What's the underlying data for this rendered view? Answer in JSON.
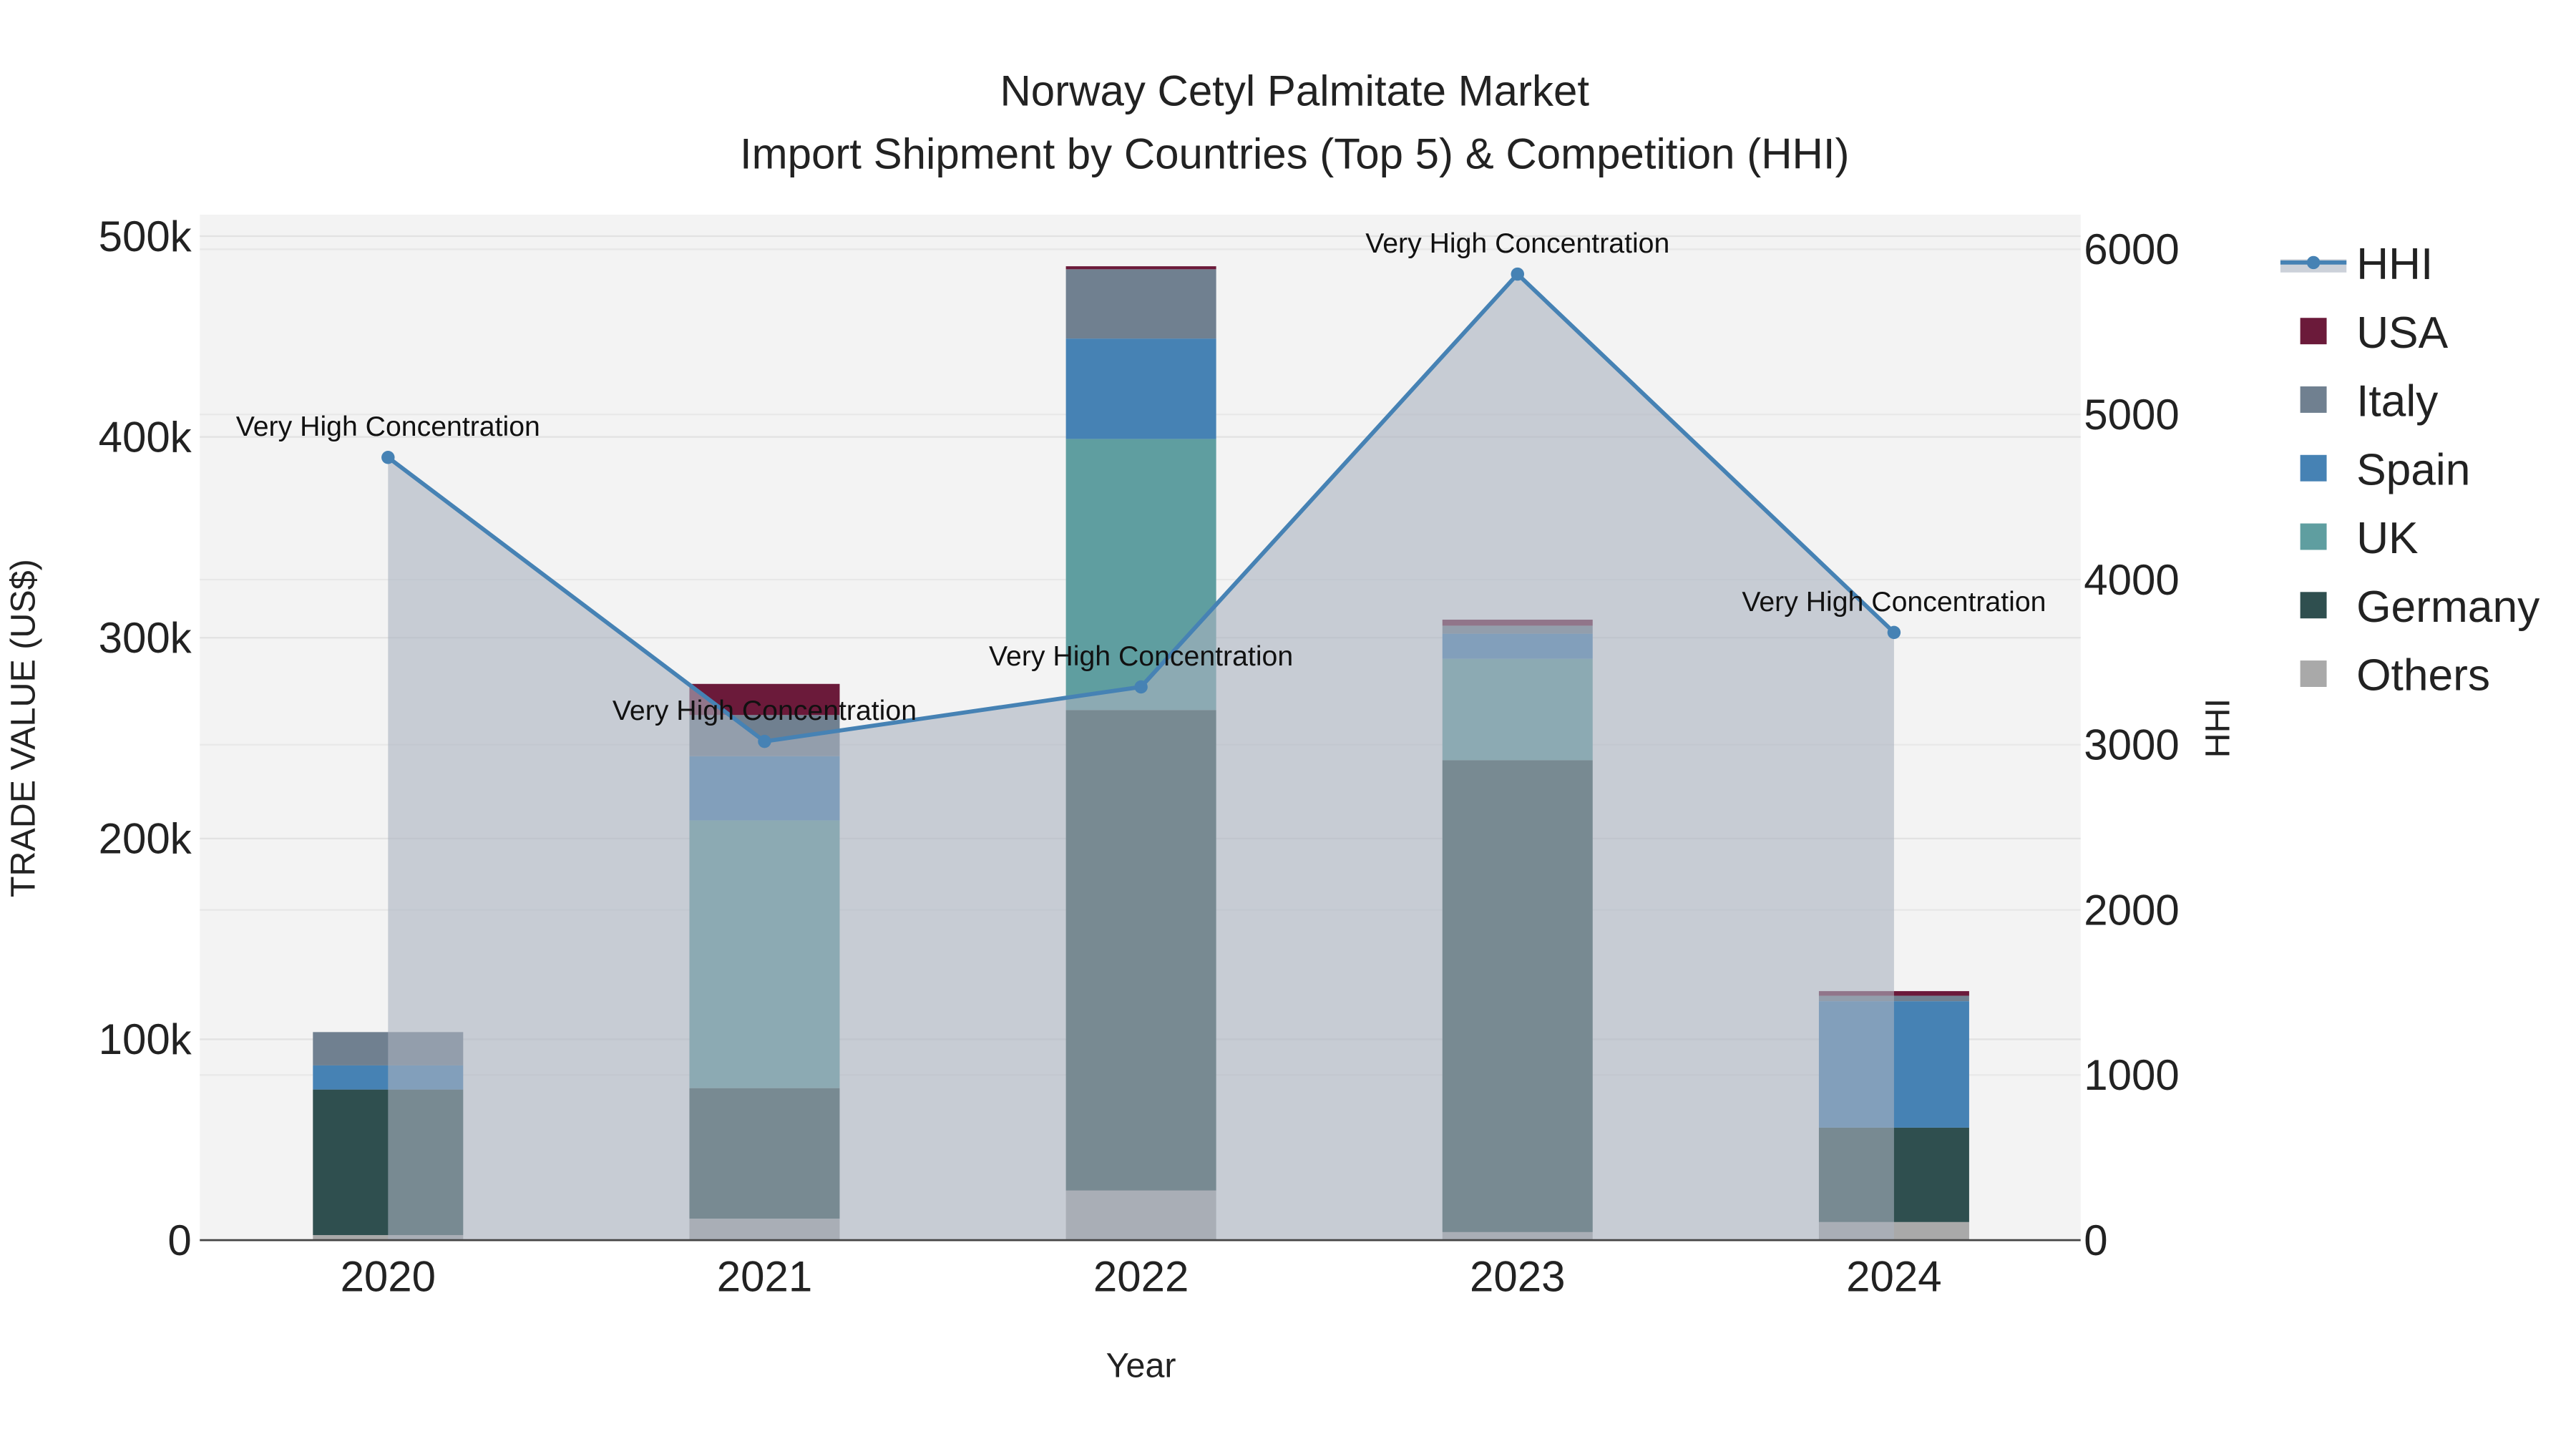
{
  "chart_data": {
    "type": "bar",
    "title": "Norway Cetyl Palmitate Market",
    "subtitle": "Import Shipment by Countries (Top 5) & Competition (HHI)",
    "xlabel": "Year",
    "ylabel": "TRADE VALUE (US$)",
    "y2label": "HHI",
    "categories": [
      "2020",
      "2021",
      "2022",
      "2023",
      "2024"
    ],
    "ylim": [
      0,
      510000
    ],
    "y2lim": [
      0,
      6200
    ],
    "yticks": [
      0,
      100000,
      200000,
      300000,
      400000,
      500000
    ],
    "ytick_labels": [
      "0",
      "100k",
      "200k",
      "300k",
      "400k",
      "500k"
    ],
    "y2ticks": [
      0,
      1000,
      2000,
      3000,
      4000,
      5000,
      6000
    ],
    "y2tick_labels": [
      "0",
      "1000",
      "2000",
      "3000",
      "4000",
      "5000",
      "6000"
    ],
    "stacked": true,
    "series": [
      {
        "name": "Others",
        "color": "#a9a9a9",
        "values": [
          2500,
          10700,
          24700,
          4000,
          9000
        ]
      },
      {
        "name": "Germany",
        "color": "#2f4f4f",
        "values": [
          72500,
          65000,
          239300,
          235000,
          47000
        ]
      },
      {
        "name": "UK",
        "color": "#5f9ea0",
        "values": [
          0,
          133300,
          135000,
          50500,
          0
        ]
      },
      {
        "name": "Spain",
        "color": "#4682b4",
        "values": [
          12000,
          32000,
          50000,
          12500,
          63000
        ]
      },
      {
        "name": "Italy",
        "color": "#708090",
        "values": [
          16600,
          20500,
          34500,
          4000,
          2700
        ]
      },
      {
        "name": "USA",
        "color": "#6b1a3a",
        "values": [
          0,
          15500,
          1500,
          3000,
          2300
        ]
      }
    ],
    "line": {
      "name": "HHI",
      "color": "#4682b4",
      "values": [
        4740,
        3020,
        3350,
        5850,
        3680
      ],
      "annotations": [
        "Very High Concentration",
        "Very High Concentration",
        "Very High Concentration",
        "Very High Concentration",
        "Very High Concentration"
      ]
    },
    "legend": [
      "HHI",
      "USA",
      "Italy",
      "Spain",
      "UK",
      "Germany",
      "Others"
    ],
    "legend_position": "right",
    "grid": true
  }
}
